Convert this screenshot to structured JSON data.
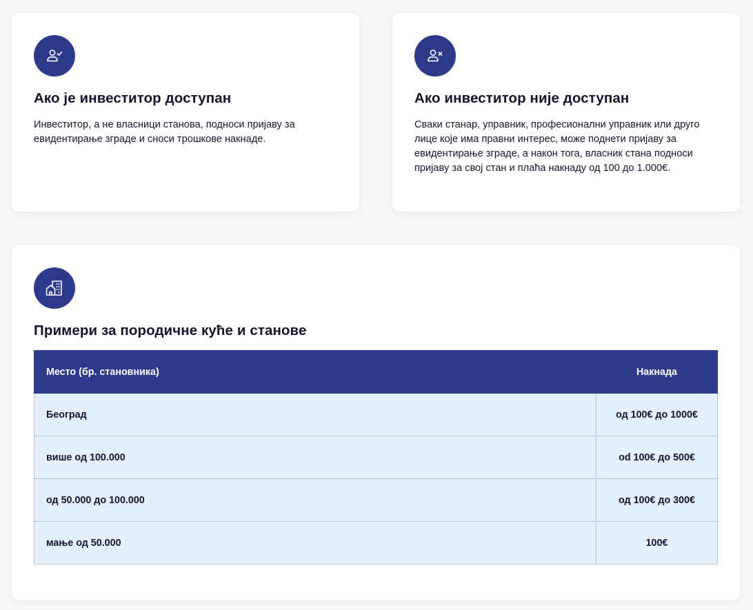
{
  "cards": {
    "available": {
      "icon": "user-check-icon",
      "title": "Ако је инвеститор доступан",
      "text": "Инвеститор, а не власници станова, подноси пријаву за евидентирање зграде и сноси трошкове накнаде."
    },
    "unavailable": {
      "icon": "user-x-icon",
      "title": "Ако инвеститор није доступан",
      "text": "Сваки станар, управник, професионални управник или друго лице које има правни интерес, може поднети пријаву за евидентирање зграде, а након тога, власник стана подноси пријаву за свој стан и плаћа накнаду од 100 до 1.000€."
    },
    "examples": {
      "icon": "buildings-icon",
      "title": "Примери за породичне куће и станове",
      "table": {
        "headers": {
          "place": "Место (бр. становника)",
          "fee": "Накнада"
        },
        "rows": [
          {
            "place": "Београд",
            "fee": "од 100€ до 1000€"
          },
          {
            "place": "више од 100.000",
            "fee": "od 100€ до 500€"
          },
          {
            "place": "од 50.000 до 100.000",
            "fee": "од 100€ до 300€"
          },
          {
            "place": "мање од 50.000",
            "fee": "100€"
          }
        ]
      }
    }
  },
  "colors": {
    "accent": "#2d3a8c",
    "row_background": "#e4f1fd",
    "text": "#14142b",
    "page_background": "#f6f6f7"
  }
}
